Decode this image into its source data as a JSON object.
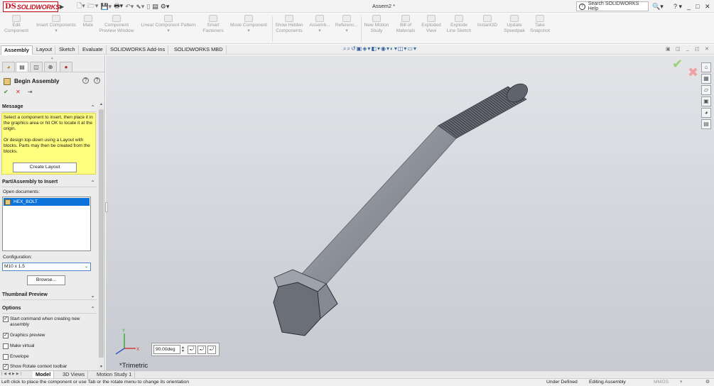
{
  "titlebar": {
    "logo_prefix": "DS",
    "logo_text": "SOLIDWORKS",
    "document_title": "Assem2 *",
    "help_search_placeholder": "Search SOLIDWORKS Help",
    "help_menu": "? ▾",
    "window_controls": {
      "minimize": "_",
      "restore": "□",
      "close": "✕"
    }
  },
  "command_manager": [
    {
      "line1": "Edit",
      "line2": "Component"
    },
    {
      "line1": "Insert Components",
      "line2": "▾"
    },
    {
      "line1": "Mate",
      "line2": ""
    },
    {
      "line1": "Component",
      "line2": "Preview Window"
    },
    {
      "line1": "Linear Component Pattern",
      "line2": "▾"
    },
    {
      "line1": "Smart",
      "line2": "Fasteners"
    },
    {
      "line1": "Move Component",
      "line2": "▾"
    },
    {
      "line1": "Show Hidden",
      "line2": "Components"
    },
    {
      "line1": "Assemb...",
      "line2": "▾"
    },
    {
      "line1": "Referenc...",
      "line2": "▾"
    },
    {
      "line1": "New Motion",
      "line2": "Study"
    },
    {
      "line1": "Bill of",
      "line2": "Materials"
    },
    {
      "line1": "Exploded",
      "line2": "View"
    },
    {
      "line1": "Explode",
      "line2": "Line Sketch"
    },
    {
      "line1": "Instant3D",
      "line2": ""
    },
    {
      "line1": "Update",
      "line2": "Speedpak"
    },
    {
      "line1": "Take",
      "line2": "Snapshot"
    }
  ],
  "tabs": [
    "Assembly",
    "Layout",
    "Sketch",
    "Evaluate",
    "SOLIDWORKS Add-Ins",
    "SOLIDWORKS MBD"
  ],
  "active_tab": "Assembly",
  "property_manager": {
    "title": "Begin Assembly",
    "ok_icon": "✔",
    "cancel_icon": "✕",
    "pin_icon": "⇥",
    "message": {
      "header": "Message",
      "paragraph1": "Select a component to insert, then place it in the graphics area or hit OK to locate it at the origin.",
      "paragraph2": "Or design top-down using a Layout with blocks. Parts may then be created from the blocks.",
      "button": "Create Layout"
    },
    "part_to_insert": {
      "header": "Part/Assembly to Insert",
      "open_documents_label": "Open documents:",
      "documents": [
        "HEX_BOLT"
      ],
      "configuration_label": "Configuration:",
      "configuration_value": "M10 x 1.5",
      "browse_button": "Browse..."
    },
    "thumbnail_header": "Thumbnail Preview",
    "options": {
      "header": "Options",
      "items": [
        {
          "label": "Start command when creating new assembly",
          "checked": true
        },
        {
          "label": "Graphics preview",
          "checked": true
        },
        {
          "label": "Make virtual",
          "checked": false
        },
        {
          "label": "Envelope",
          "checked": false
        },
        {
          "label": "Show Rotate context toolbar",
          "checked": true
        }
      ]
    }
  },
  "graphics": {
    "rotate_value": "90.00deg",
    "view_orientation": "*Trimetric",
    "triad": {
      "x": "X",
      "y": "Y"
    }
  },
  "bottom_tabs": [
    "Model",
    "3D Views",
    "Motion Study 1"
  ],
  "active_bottom_tab": "Model",
  "status_bar": {
    "message": "Left click to place the component or use Tab or the rotate menu to change its orientation",
    "definition": "Under Defined",
    "mode": "Editing Assembly",
    "units": "MMGS",
    "units_arrow": "▾"
  },
  "colors": {
    "brand_red": "#c8101f",
    "message_yellow": "#ffff7f",
    "selection_blue": "#0a72d8",
    "bolt_gray": "#8e929c"
  }
}
